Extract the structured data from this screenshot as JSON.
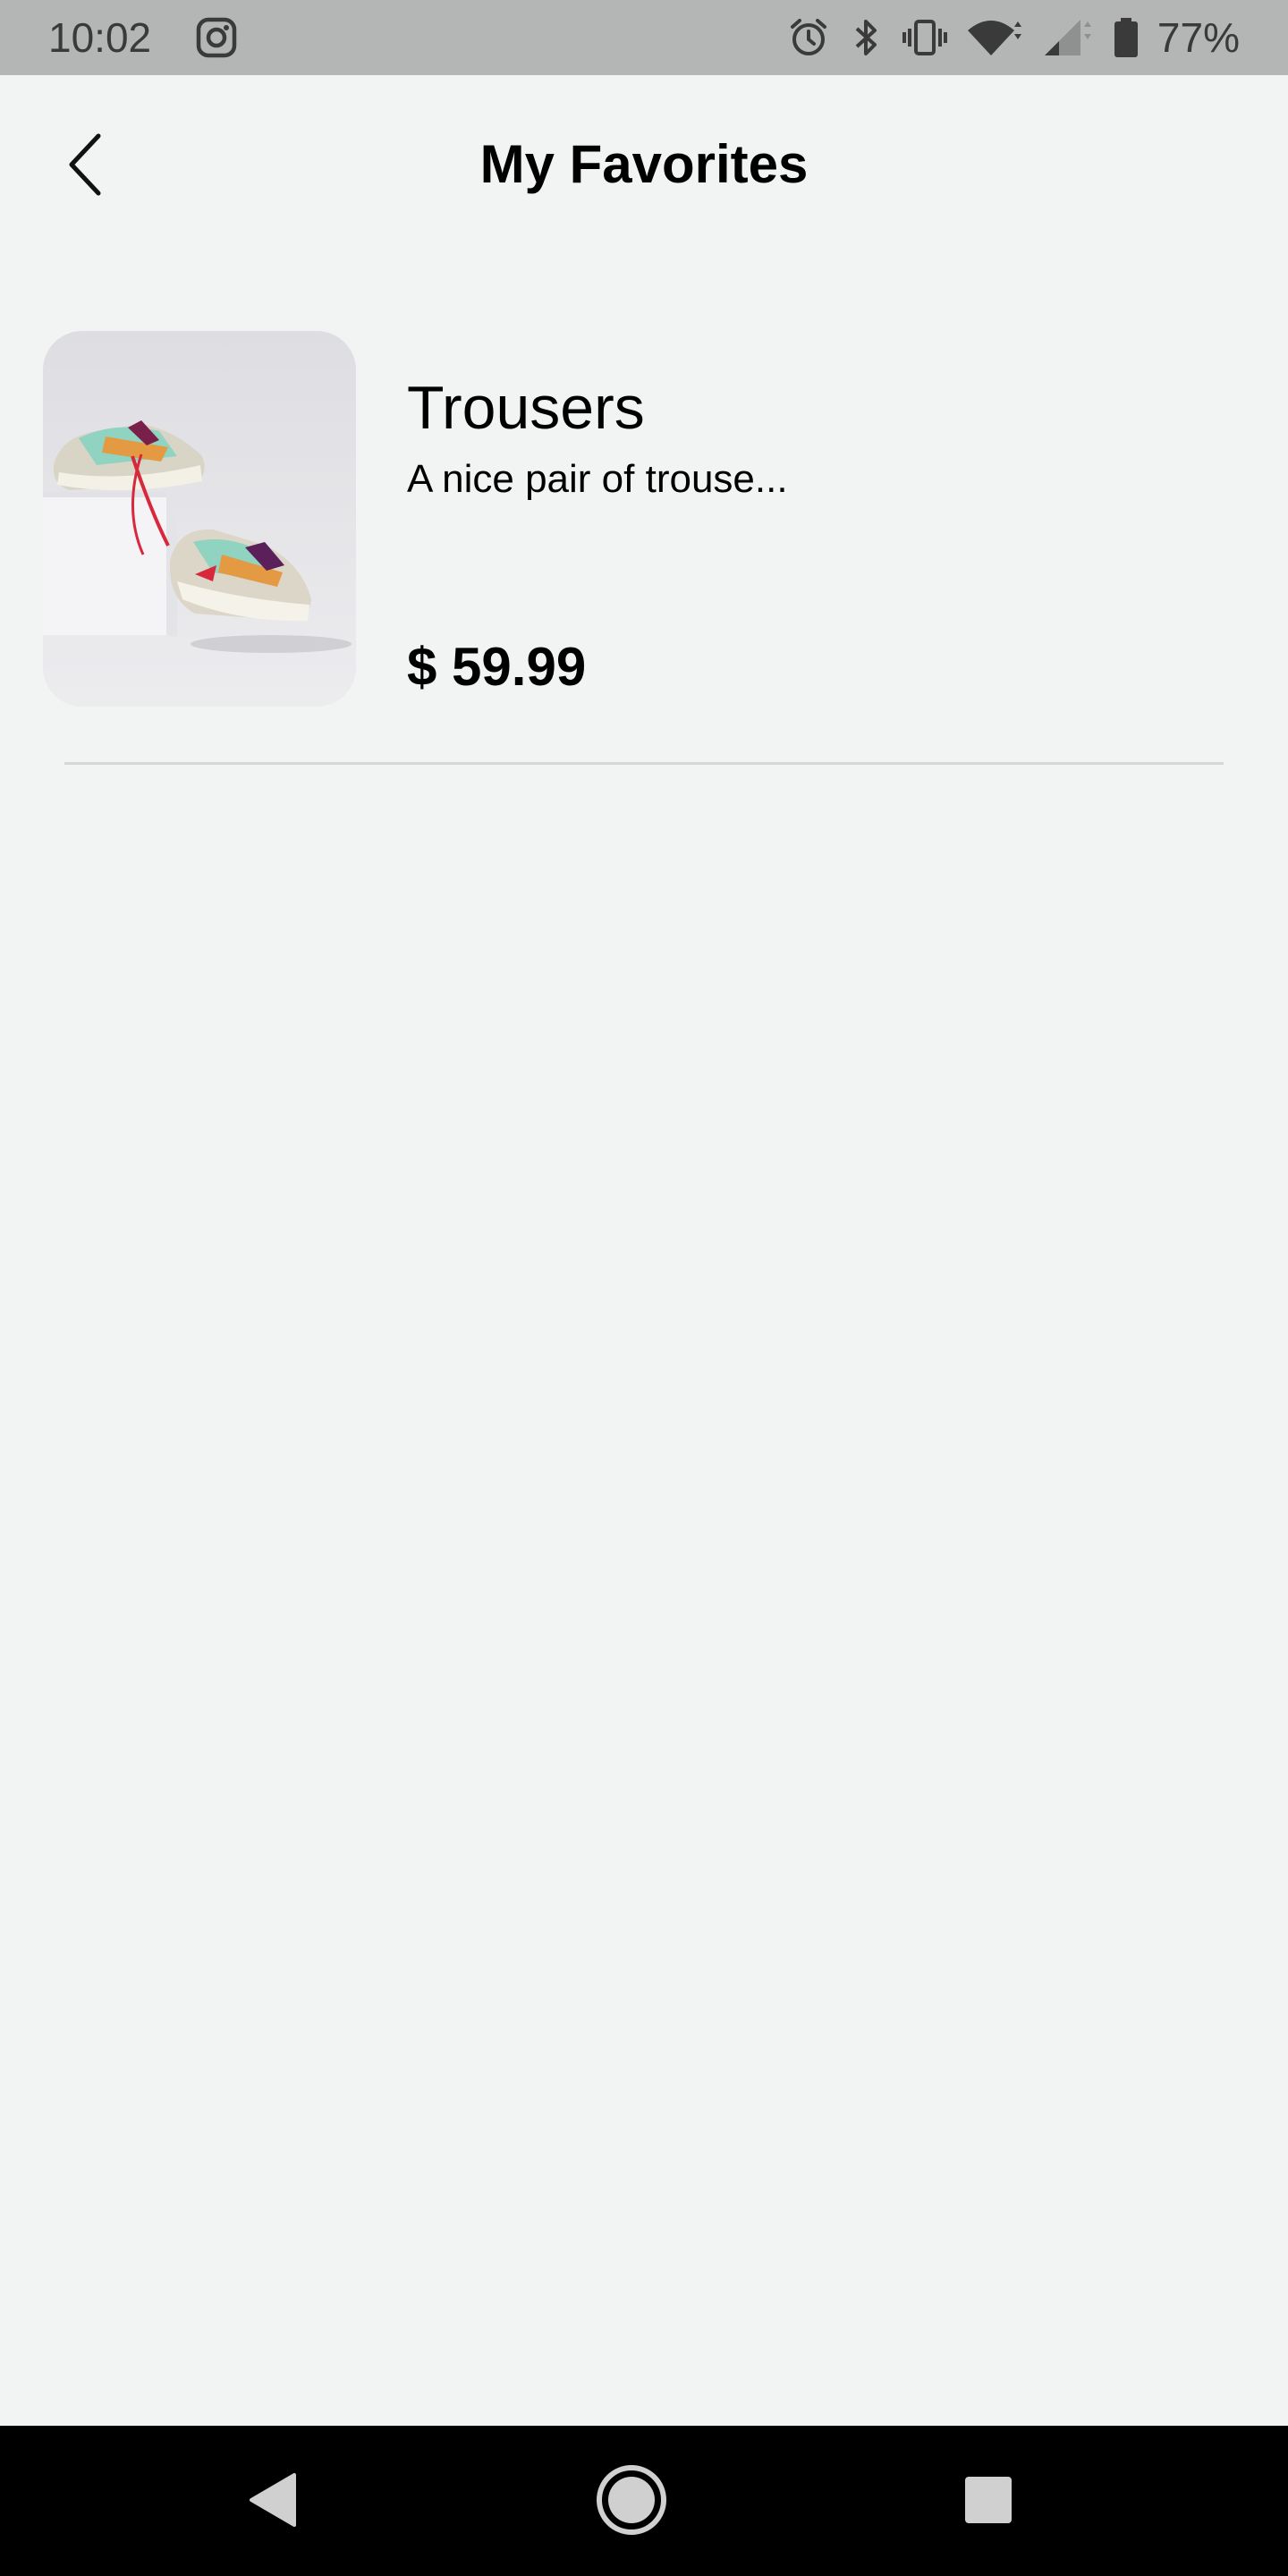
{
  "status_bar": {
    "time": "10:02",
    "battery_percent": "77%",
    "icons": [
      "instagram-icon",
      "alarm-icon",
      "bluetooth-icon",
      "vibrate-icon",
      "wifi-icon",
      "cell-signal-icon",
      "battery-icon"
    ]
  },
  "header": {
    "title": "My Favorites",
    "back_icon": "chevron-left-icon"
  },
  "favorites": [
    {
      "name": "Trousers",
      "description": "A nice pair of trouse...",
      "price": "$ 59.99"
    }
  ],
  "nav_bar": {
    "icons": [
      "back-triangle-icon",
      "home-circle-icon",
      "recents-square-icon"
    ]
  },
  "colors": {
    "background": "#f2f4f3",
    "status_bar": "#b3b6b5",
    "nav_bar": "#000000",
    "divider": "#d6d8d7"
  }
}
